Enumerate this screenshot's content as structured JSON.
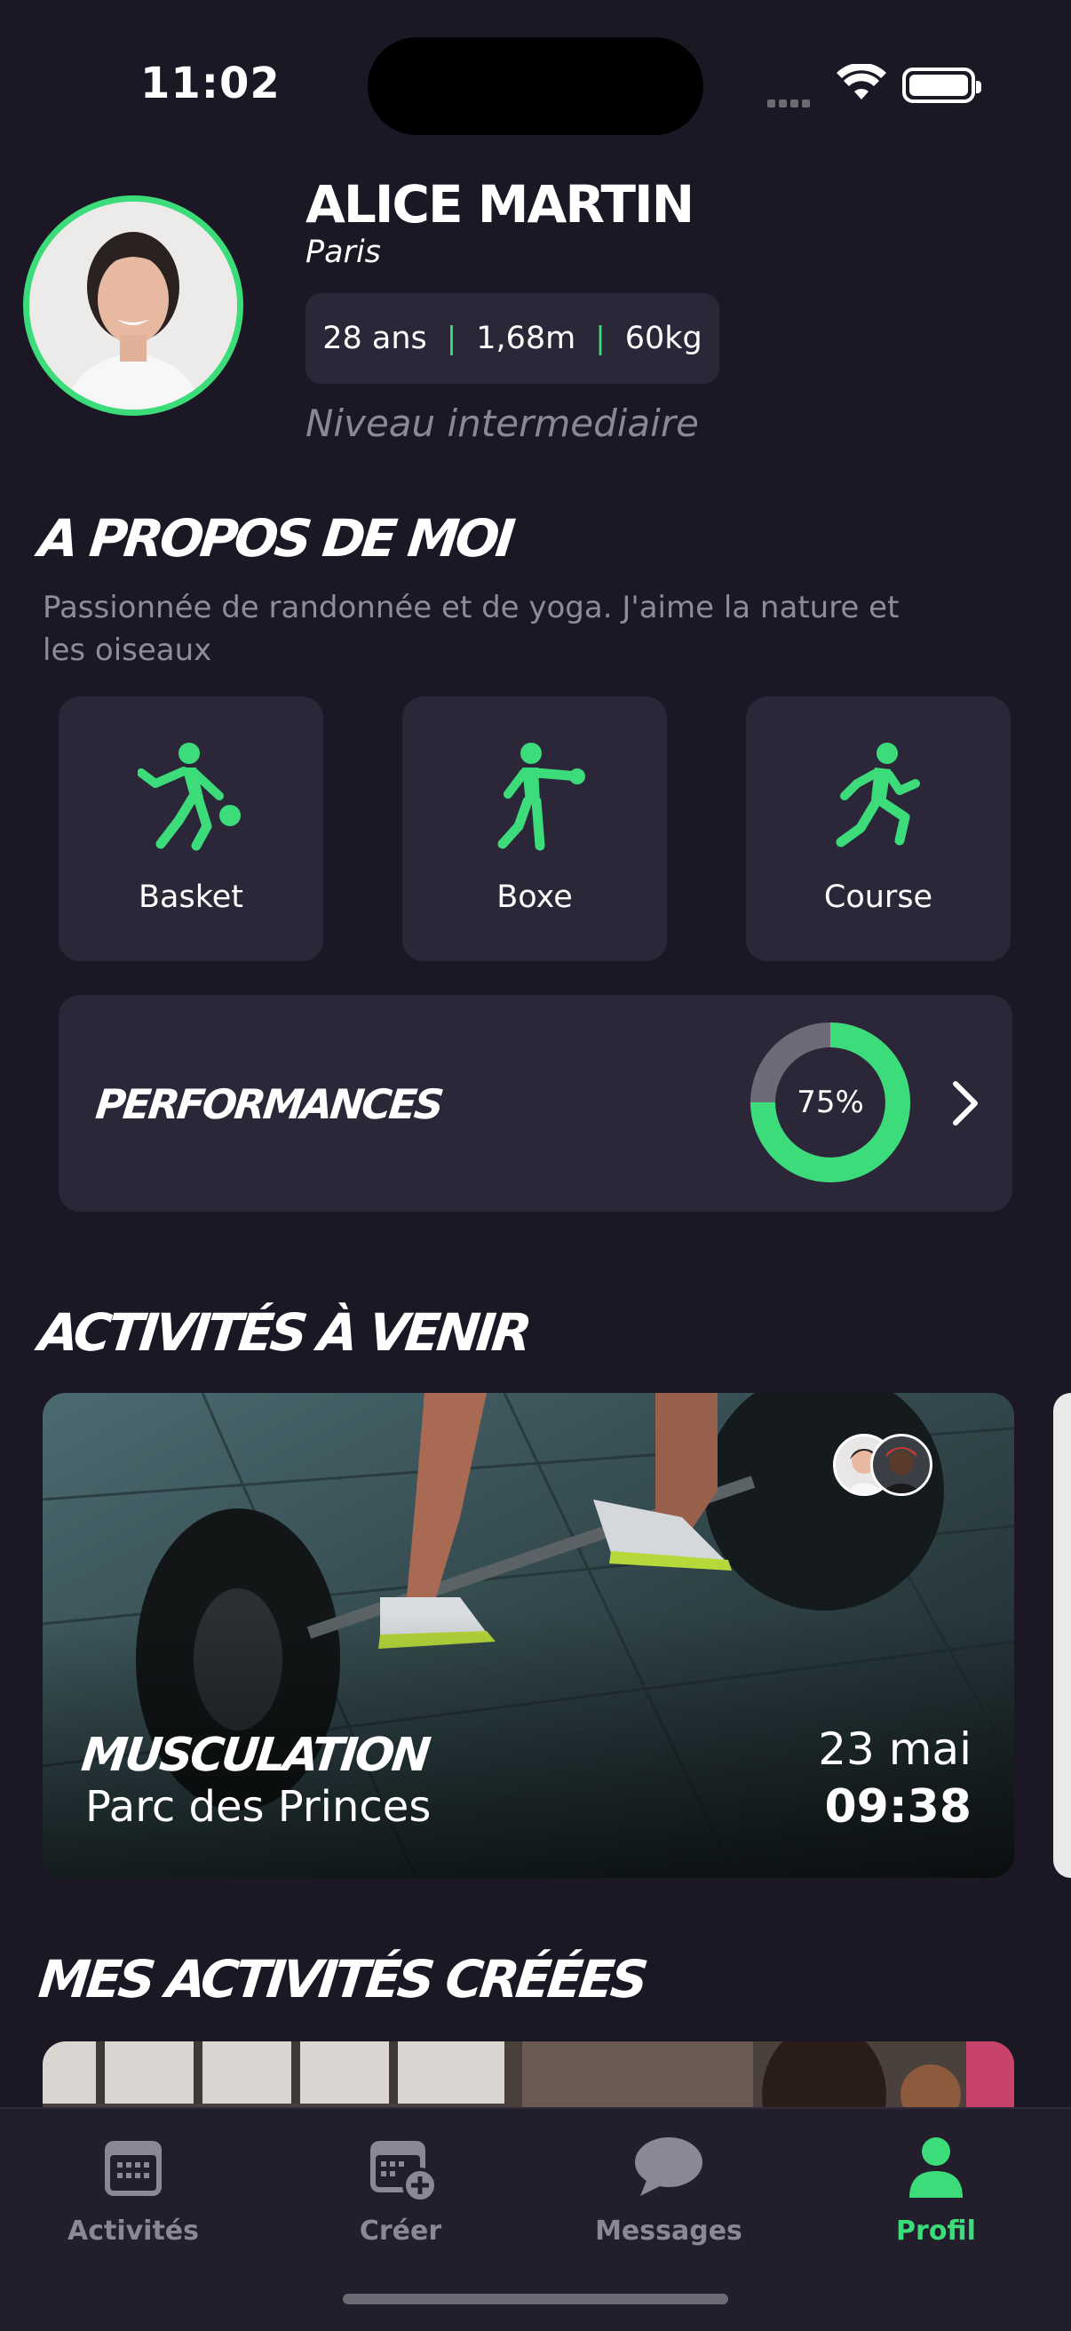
{
  "status": {
    "time": "11:02"
  },
  "profile": {
    "name": "ALICE MARTIN",
    "city": "Paris",
    "age": "28 ans",
    "height": "1,68m",
    "weight": "60kg",
    "level": "Niveau intermediaire"
  },
  "about": {
    "title": "A PROPOS DE MOI",
    "bio": "Passionnée de randonnée et de yoga. J'aime la nature et les oiseaux"
  },
  "sports": [
    {
      "label": "Basket",
      "icon": "basketball-player-icon"
    },
    {
      "label": "Boxe",
      "icon": "boxing-figure-icon"
    },
    {
      "label": "Course",
      "icon": "runner-icon"
    }
  ],
  "performances": {
    "title": "PERFORMANCES",
    "percent_label": "75%",
    "value": 0.75
  },
  "upcoming": {
    "title": "ACTIVITÉS À VENIR",
    "card": {
      "title": "MUSCULATION",
      "place": "Parc des Princes",
      "date": "23 mai",
      "time": "09:38"
    }
  },
  "created": {
    "title": "MES ACTIVITÉS CRÉÉES"
  },
  "tabs": [
    {
      "label": "Activités",
      "icon": "calendar-icon"
    },
    {
      "label": "Créer",
      "icon": "calendar-add-icon"
    },
    {
      "label": "Messages",
      "icon": "chat-bubble-icon"
    },
    {
      "label": "Profil",
      "icon": "person-icon"
    }
  ],
  "colors": {
    "accent": "#3cdc7a",
    "background": "#1b1725",
    "card": "#2b2739",
    "muted": "#8b8795"
  }
}
